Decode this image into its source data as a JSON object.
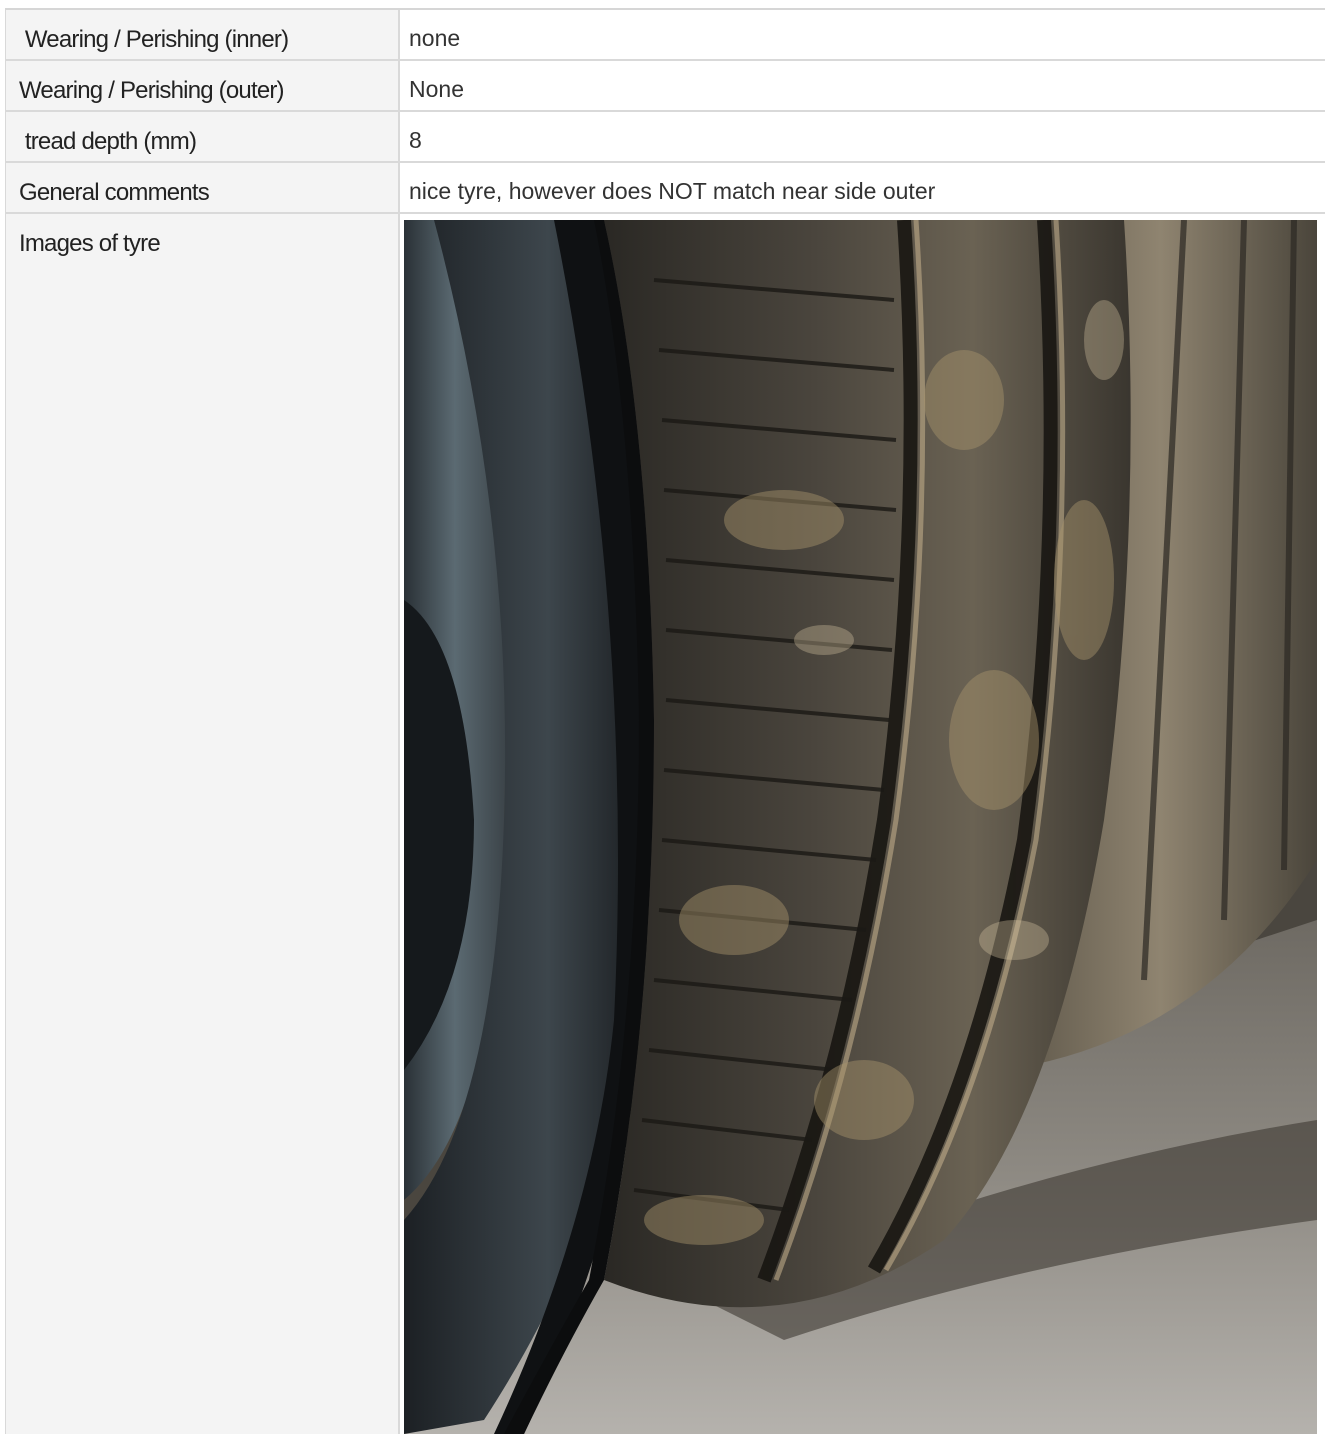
{
  "rows": [
    {
      "label": " Wearing / Perishing (inner)",
      "value": "none"
    },
    {
      "label": "Wearing / Perishing (outer)",
      "value": "None"
    },
    {
      "label": " tread depth (mm)",
      "value": "8"
    },
    {
      "label": "General comments",
      "value": "nice tyre, however does NOT match near side outer"
    }
  ],
  "images": {
    "label": "Images of tyre",
    "photo_alt": "Photo of tyre tread and sidewall"
  }
}
